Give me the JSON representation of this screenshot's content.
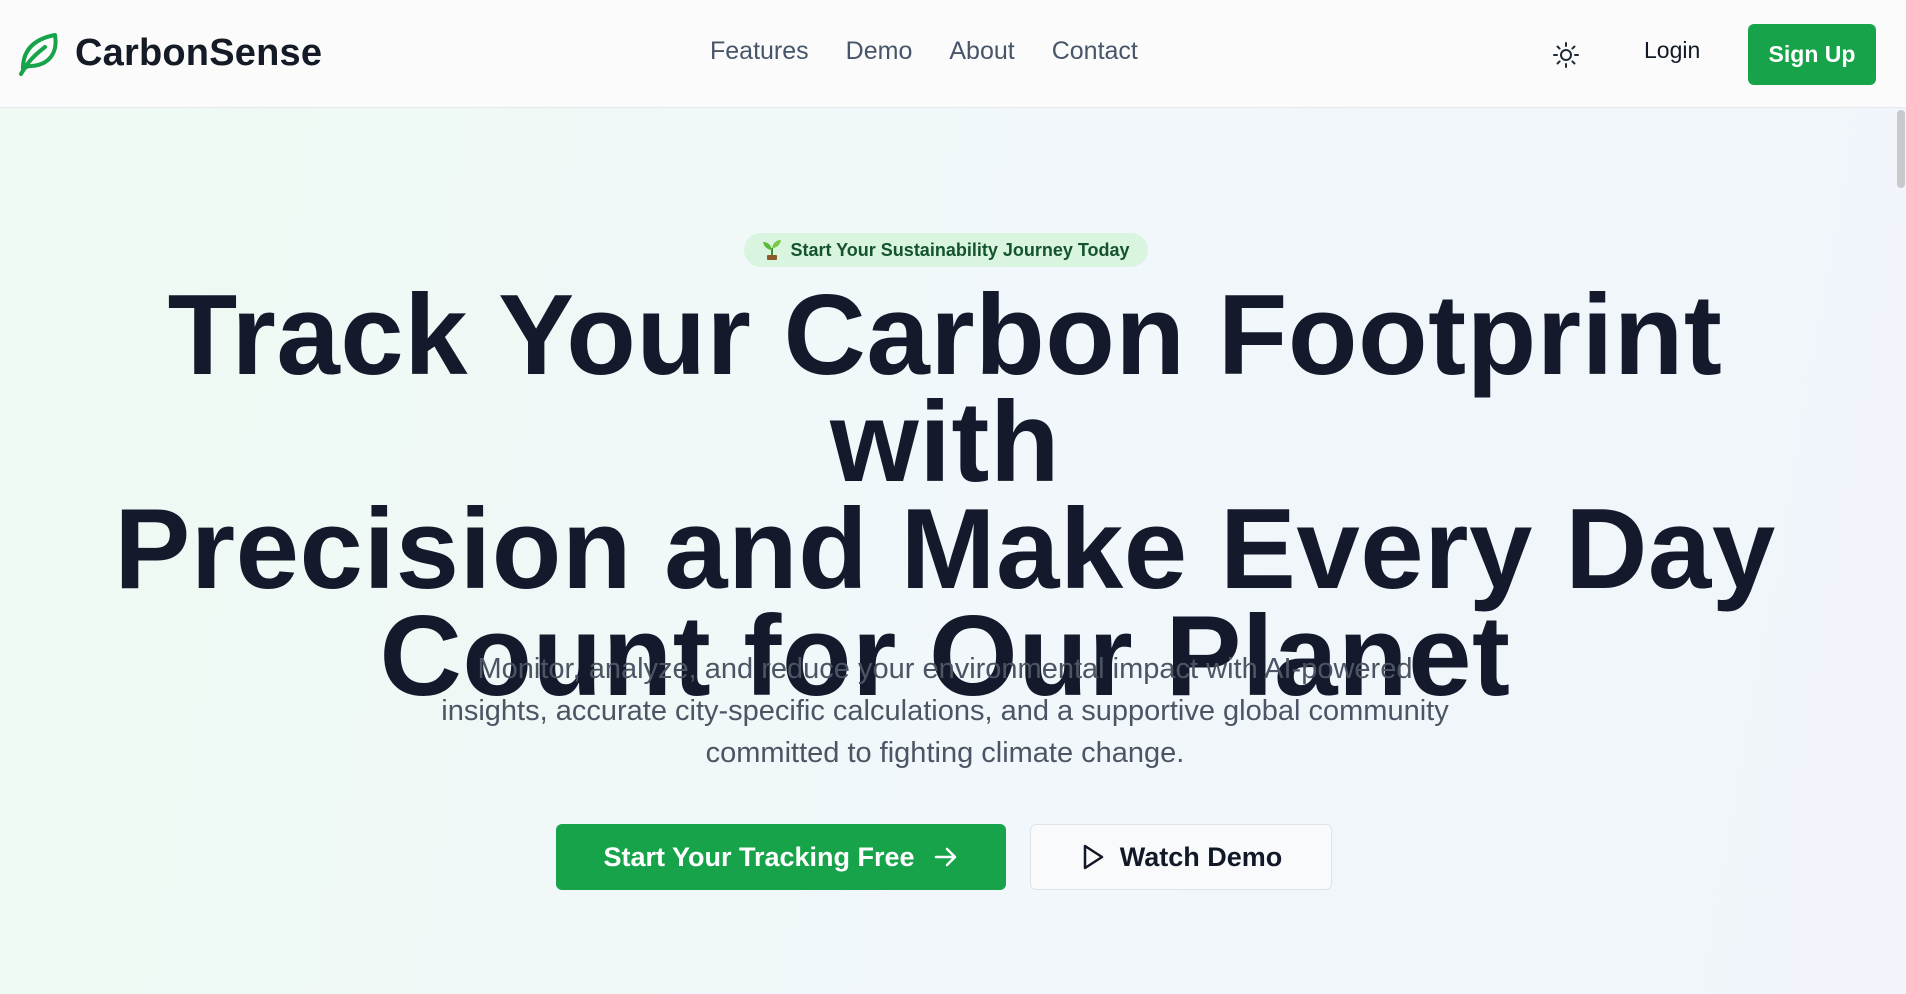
{
  "brand": {
    "name": "CarbonSense",
    "logo_icon": "leaf-icon",
    "accent_color": "#16a34a"
  },
  "nav": {
    "links": [
      {
        "label": "Features"
      },
      {
        "label": "Demo"
      },
      {
        "label": "About"
      },
      {
        "label": "Contact"
      }
    ],
    "theme_toggle_icon": "sun-icon",
    "login_label": "Login",
    "signup_label": "Sign Up"
  },
  "hero": {
    "badge": {
      "icon": "seedling-icon",
      "text": "Start Your Sustainability Journey Today"
    },
    "title_lines": [
      "Track Your Carbon Footprint with",
      "Precision and Make Every Day",
      "Count for Our Planet"
    ],
    "subtitle_lines": [
      "Monitor, analyze, and reduce your environmental impact with AI-powered",
      "insights, accurate city-specific calculations, and a supportive global community",
      "committed to fighting climate change."
    ],
    "primary_cta": {
      "label": "Start Your Tracking Free",
      "icon": "arrow-right-icon"
    },
    "secondary_cta": {
      "label": "Watch Demo",
      "icon": "play-icon"
    }
  }
}
